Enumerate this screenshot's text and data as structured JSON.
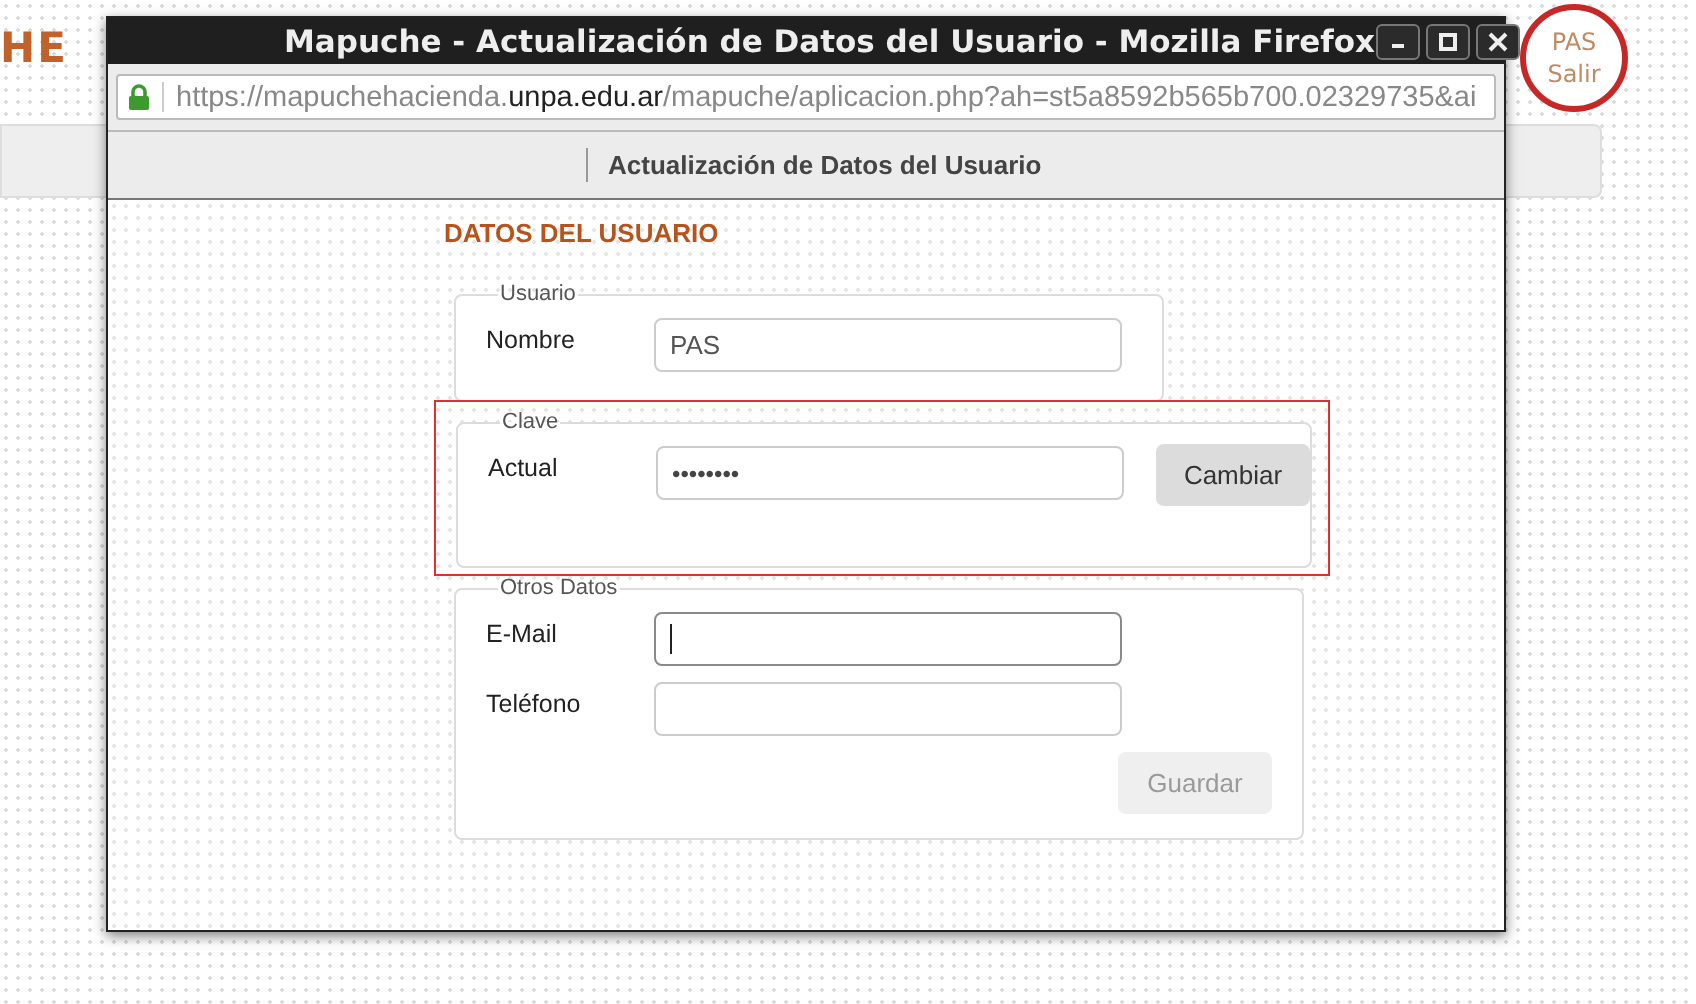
{
  "background_page": {
    "logo_text": "HE",
    "user_badge": {
      "name": "PAS",
      "logout": "Salir"
    }
  },
  "window": {
    "title": "Mapuche - Actualización de Datos del Usuario - Mozilla Firefox",
    "secure": true,
    "url": {
      "origin_start": "https://mapuchehacienda.",
      "domain": "unpa.edu.ar",
      "path": "/mapuche/aplicacion.php?ah=st5a8592b565b700.02329735&ai"
    }
  },
  "page_header": {
    "title": "Actualización de Datos del Usuario"
  },
  "form": {
    "heading": "DATOS DEL USUARIO",
    "sections": [
      {
        "legend": "Usuario",
        "highlighted": false,
        "fields": [
          {
            "label": "Nombre",
            "kind": "text",
            "value": "PAS",
            "focused": false
          }
        ]
      },
      {
        "legend": "Clave",
        "highlighted": true,
        "fields": [
          {
            "label": "Actual",
            "kind": "password",
            "value": "••••••••",
            "focused": false,
            "button": {
              "label": "Cambiar",
              "disabled": false
            }
          }
        ]
      },
      {
        "legend": "Otros Datos",
        "highlighted": false,
        "fields": [
          {
            "label": "E-Mail",
            "kind": "text",
            "focused": true
          },
          {
            "label": "Teléfono",
            "kind": "text",
            "focused": false
          }
        ],
        "button": {
          "label": "Guardar",
          "disabled": true
        }
      }
    ]
  }
}
